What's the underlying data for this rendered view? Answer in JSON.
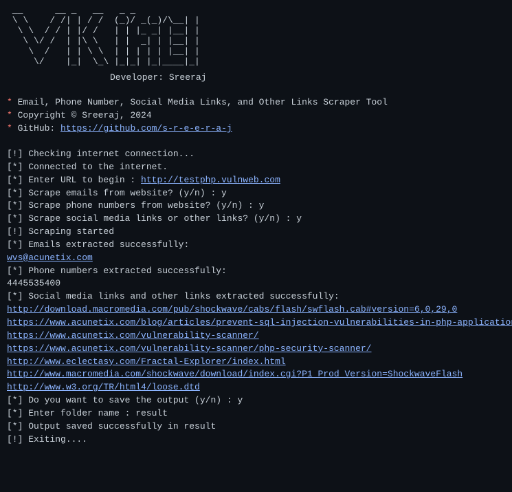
{
  "ascii_art": " __      __ _   __     _                \n \\ \\    / /| | / /    ( )/\\__ |        \n  \\ \\  / / | || |     |/ |  __||       \n   \\ \\/ /  | | \\ \\   | | | |__  | |__ \n    \\  /   | |  \\ \\  | | |  __| |  __ \\\n     \\/    |_|   \\_\\ |_| |____| |_|  |_|",
  "developer_label": "Developer: Sreeraj",
  "info": {
    "line1": "Email, Phone Number, Social Media Links, and Other Links Scraper Tool",
    "line2": "Copyright © Sreeraj, 2024",
    "line3_prefix": "GitHub: ",
    "github_url": "https://github.com/s-r-e-e-r-a-j"
  },
  "lines": {
    "check_conn": "[!] Checking internet connection...",
    "connected": "[*] Connected to the internet.",
    "enter_url_prefix": "[*] Enter URL to begin : ",
    "target_url": "http://testphp.vulnweb.com",
    "scrape_emails": "[*] Scrape emails from website? (y/n) : y",
    "scrape_phones": "[*] Scrape phone numbers from website? (y/n) : y",
    "scrape_links": "[*] Scrape social media links or other links? (y/n) : y",
    "scraping_started": "[!] Scraping started",
    "emails_extracted": "[*] Emails extracted successfully:",
    "email_result": "wvs@acunetix.com",
    "phones_extracted": "[*] Phone numbers extracted successfully:",
    "phone_result": "4445535400",
    "links_extracted": "[*] Social media links and other links extracted successfully:",
    "link1": "http://download.macromedia.com/pub/shockwave/cabs/flash/swflash.cab#version=6,0,29,0",
    "link2": "https://www.acunetix.com/blog/articles/prevent-sql-injection-vulnerabilities-in-php-applications/",
    "link3": "https://www.acunetix.com/vulnerability-scanner/",
    "link4": "https://www.acunetix.com/vulnerability-scanner/php-security-scanner/",
    "link5": "http://www.eclectasy.com/Fractal-Explorer/index.html",
    "link6": "http://www.macromedia.com/shockwave/download/index.cgi?P1_Prod_Version=ShockwaveFlash",
    "link7": "http://www.w3.org/TR/html4/loose.dtd",
    "save_prompt": "[*] Do you want to save the output (y/n) : y",
    "folder_prompt": "[*] Enter folder name : result",
    "saved_success": "[*] Output saved successfully in result",
    "exiting": "[!] Exiting...."
  }
}
